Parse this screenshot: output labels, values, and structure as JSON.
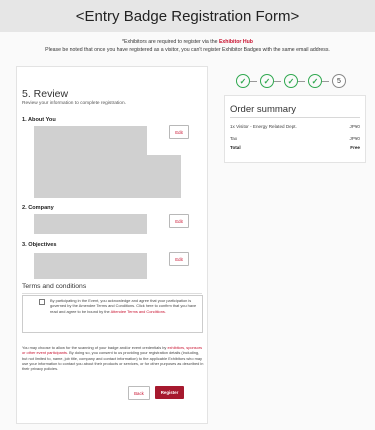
{
  "page": {
    "title": "<Entry Badge Registration Form>"
  },
  "notice": {
    "line1_prefix": "*Exhibitors are required to register via the",
    "line1_link": "Exhibitor Hub",
    "line2": "Please be noted that once you have registered as a visitor, you can't register Exhibitor Badges with the same email address."
  },
  "form": {
    "heading": "5. Review",
    "subheading": "Review your information to complete registration.",
    "sections": [
      {
        "title": "1. About You",
        "edit_label": "Edit"
      },
      {
        "title": "2. Company",
        "edit_label": "Edit"
      },
      {
        "title": "3. Objectives",
        "edit_label": "Edit"
      }
    ],
    "terms": {
      "heading": "Terms and conditions",
      "text_before": "By participating in the Event, you acknowledge and agree that your participation is governed by the Amendee Terms and Conditions. Click here to confirm that you have read and agree to be bound by the",
      "link": "Attendee Terms and Conditions.",
      "checked": false
    },
    "consent": {
      "before": "You may choose to allow for the scanning of your badge and/or event credentials by",
      "link": "exhibitors, sponsors or other event participants.",
      "after": "By doing so, you consent to us providing your registration details (including, but not limited to, name, job title, company and contact information) to the applicable Exhibitors who may use your information to contact you about their products or services, or for other purposes as described in their privacy policies."
    },
    "buttons": {
      "back": "Back",
      "register": "Register"
    }
  },
  "stepper": {
    "done_icon": "check-icon",
    "current_step_number": "5",
    "completed_steps": 4
  },
  "summary": {
    "heading": "Order summary",
    "rows": [
      {
        "label": "1x Visitor - Energy Related Dept.",
        "value": "JP¥0"
      },
      {
        "label": "Tax",
        "value": "JP¥0"
      },
      {
        "label": "Total",
        "value": "Free"
      }
    ]
  },
  "colors": {
    "accent": "#a6192e",
    "link": "#c8102e",
    "step_done": "#2fa84f"
  }
}
